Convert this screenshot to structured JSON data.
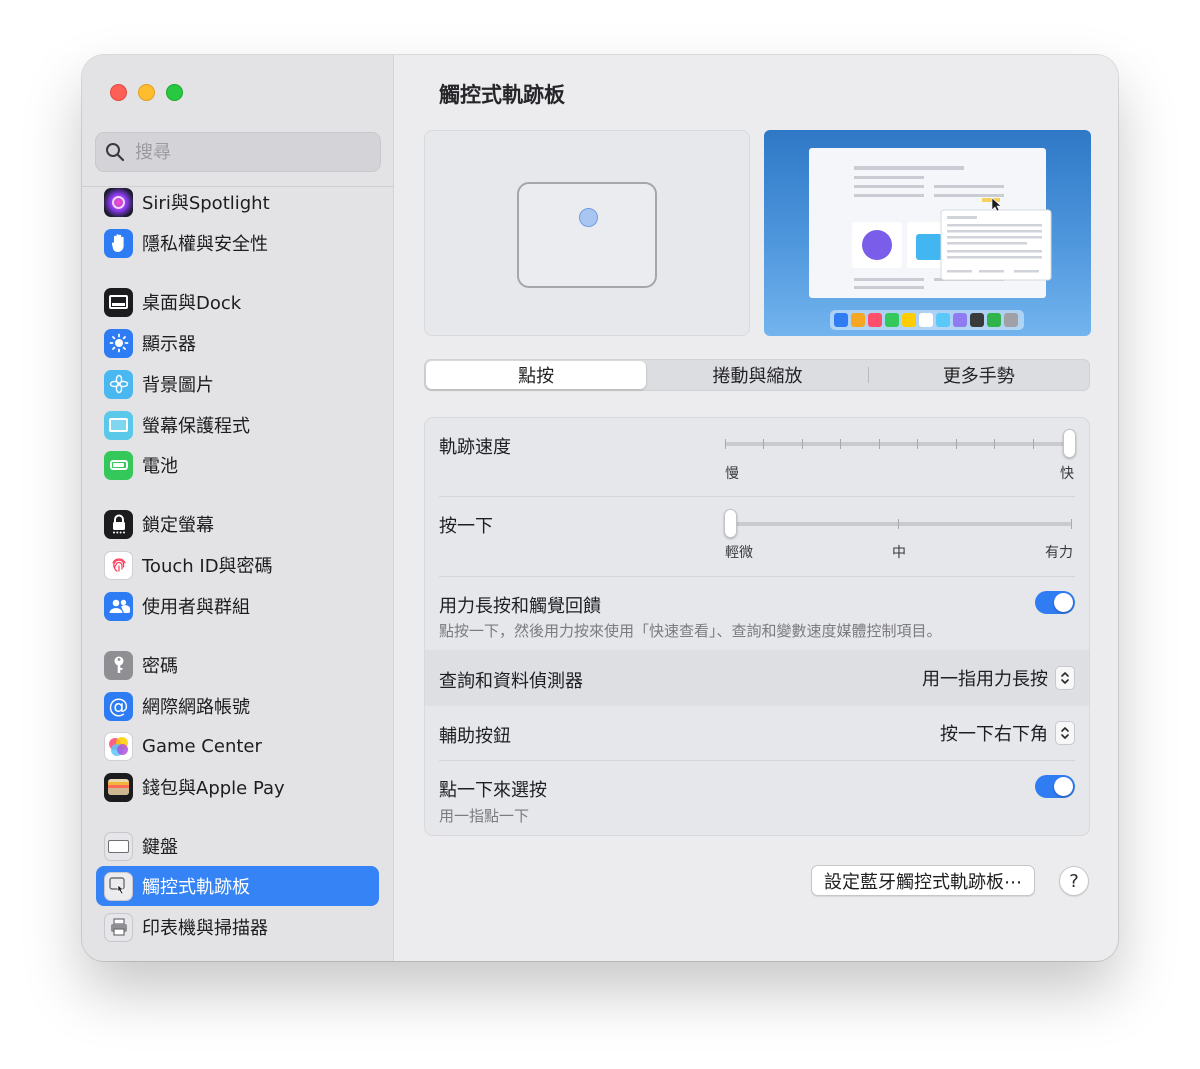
{
  "window": {
    "title": "觸控式軌跡板"
  },
  "search": {
    "placeholder": "搜尋"
  },
  "sidebar": {
    "items": [
      {
        "label": "Siri與Spotlight",
        "icon": "siri-icon"
      },
      {
        "label": "隱私權與安全性",
        "icon": "hand-icon"
      },
      {
        "label": "桌面與Dock",
        "icon": "dock-icon"
      },
      {
        "label": "顯示器",
        "icon": "sun-icon"
      },
      {
        "label": "背景圖片",
        "icon": "flower-icon"
      },
      {
        "label": "螢幕保護程式",
        "icon": "screensaver-icon"
      },
      {
        "label": "電池",
        "icon": "battery-icon"
      },
      {
        "label": "鎖定螢幕",
        "icon": "lock-icon"
      },
      {
        "label": "Touch ID與密碼",
        "icon": "fingerprint-icon"
      },
      {
        "label": "使用者與群組",
        "icon": "users-icon"
      },
      {
        "label": "密碼",
        "icon": "key-icon"
      },
      {
        "label": "網際網路帳號",
        "icon": "at-icon"
      },
      {
        "label": "Game Center",
        "icon": "game-center-icon"
      },
      {
        "label": "錢包與Apple Pay",
        "icon": "wallet-icon"
      },
      {
        "label": "鍵盤",
        "icon": "keyboard-icon"
      },
      {
        "label": "觸控式軌跡板",
        "icon": "trackpad-icon",
        "selected": true
      },
      {
        "label": "印表機與掃描器",
        "icon": "printer-icon"
      }
    ]
  },
  "tabs": [
    {
      "label": "點按",
      "active": true
    },
    {
      "label": "捲動與縮放",
      "active": false
    },
    {
      "label": "更多手勢",
      "active": false
    }
  ],
  "settings": {
    "tracking_speed": {
      "label": "軌跡速度",
      "min_label": "慢",
      "max_label": "快",
      "value": 1.0,
      "ticks": 10
    },
    "click": {
      "label": "按一下",
      "caps": [
        "輕微",
        "中",
        "有力"
      ],
      "value": 0
    },
    "force_click": {
      "label": "用力長按和觸覺回饋",
      "description": "點按一下，然後用力按來使用「快速查看」、查詢和變數速度媒體控制項目。",
      "enabled": true
    },
    "lookup": {
      "label": "查詢和資料偵測器",
      "value": "用一指用力長按"
    },
    "secondary_click": {
      "label": "輔助按鈕",
      "value": "按一下右下角"
    },
    "tap_to_click": {
      "label": "點一下來選按",
      "description": "用一指點一下",
      "enabled": true
    }
  },
  "buttons": {
    "setup_bluetooth": "設定藍牙觸控式軌跡板⋯",
    "help": "?"
  },
  "colors": {
    "accent": "#2f7cf3",
    "sidebar_selected": "#3583f5"
  }
}
